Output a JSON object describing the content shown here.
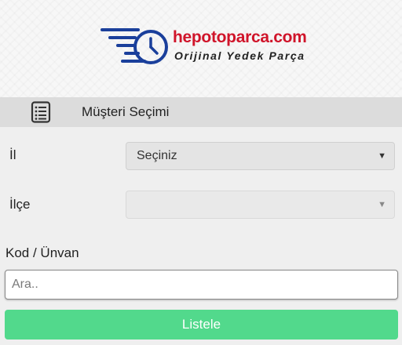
{
  "brand": {
    "name": "hepotoparca.com",
    "tagline": "Orijinal Yedek Parça",
    "colors": {
      "primary": "#d0142a",
      "icon_blue": "#1a3f9b"
    },
    "icon": "delivery-clock-icon"
  },
  "section": {
    "title": "Müşteri Seçimi",
    "icon": "list-document-icon"
  },
  "form": {
    "il": {
      "label": "İl",
      "value": "Seçiniz"
    },
    "ilce": {
      "label": "İlçe",
      "value": ""
    },
    "kod_unvan": {
      "label": "Kod / Ünvan",
      "placeholder": "Ara.."
    },
    "submit_label": "Listele",
    "submit_color": "#52d98c"
  }
}
